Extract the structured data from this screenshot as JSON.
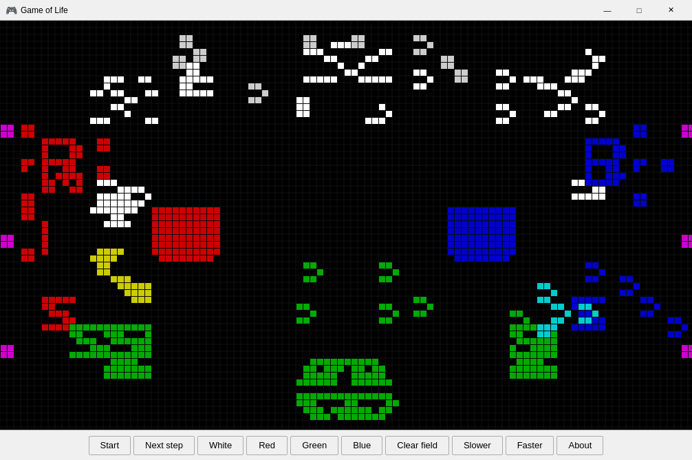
{
  "title": "Game of Life",
  "toolbar": {
    "buttons": [
      {
        "id": "start",
        "label": "Start"
      },
      {
        "id": "next-step",
        "label": "Next step"
      },
      {
        "id": "white",
        "label": "White"
      },
      {
        "id": "red",
        "label": "Red"
      },
      {
        "id": "green",
        "label": "Green"
      },
      {
        "id": "blue",
        "label": "Blue"
      },
      {
        "id": "clear-field",
        "label": "Clear field"
      },
      {
        "id": "slower",
        "label": "Slower"
      },
      {
        "id": "faster",
        "label": "Faster"
      },
      {
        "id": "about",
        "label": "About"
      }
    ]
  },
  "window_controls": {
    "minimize": "—",
    "maximize": "□",
    "close": "✕"
  },
  "colors": {
    "white": "#ffffff",
    "red": "#cc0000",
    "green": "#00aa00",
    "blue": "#0000cc",
    "yellow": "#cccc00",
    "cyan": "#00cccc",
    "magenta": "#cc00cc"
  }
}
